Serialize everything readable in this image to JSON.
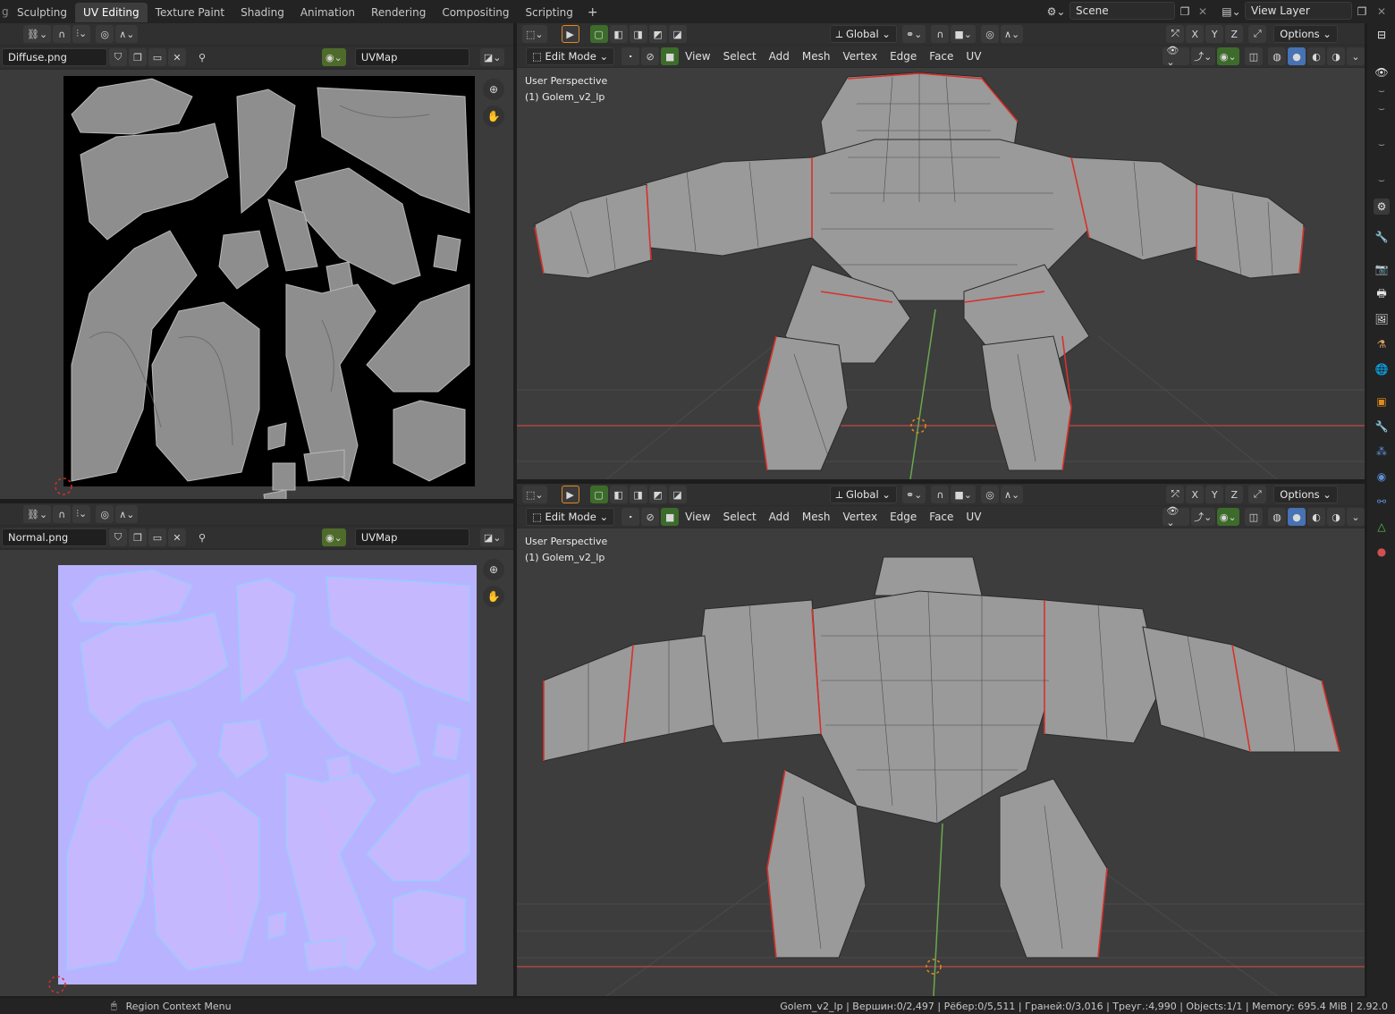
{
  "workspace_tabs": [
    "Sculpting",
    "UV Editing",
    "Texture Paint",
    "Shading",
    "Animation",
    "Rendering",
    "Compositing",
    "Scripting"
  ],
  "active_tab": "UV Editing",
  "add_tab_symbol": "+",
  "scene": {
    "label": "Scene"
  },
  "view_layer": {
    "label": "View Layer"
  },
  "uv_editor_top": {
    "image_name": "Diffuse.png",
    "uvmap": "UVMap"
  },
  "uv_editor_bottom": {
    "image_name": "Normal.png",
    "uvmap": "UVMap"
  },
  "viewport_top": {
    "mode": "Edit Mode",
    "menus": [
      "View",
      "Select",
      "Add",
      "Mesh",
      "Vertex",
      "Edge",
      "Face",
      "UV"
    ],
    "orientation": "Global",
    "axes": [
      "X",
      "Y",
      "Z"
    ],
    "options": "Options",
    "perspective": "User Perspective",
    "object": "(1) Golem_v2_lp"
  },
  "viewport_bottom": {
    "mode": "Edit Mode",
    "menus": [
      "View",
      "Select",
      "Add",
      "Mesh",
      "Vertex",
      "Edge",
      "Face",
      "UV"
    ],
    "orientation": "Global",
    "axes": [
      "X",
      "Y",
      "Z"
    ],
    "options": "Options",
    "perspective": "User Perspective",
    "object": "(1) Golem_v2_lp"
  },
  "status": {
    "context": "Region Context Menu",
    "stats": "Golem_v2_lp | Вершин:0/2,497 | Рёбер:0/5,511 | Граней:0/3,016 | Треуг.:4,990 | Objects:1/1 | Memory: 695.4 MiB | 2.92.0"
  },
  "colors": {
    "accent": "#4772b3",
    "edge_seam": "#d7312b",
    "uv_bg": "#000000",
    "normal_bg": "#b9b3ff"
  }
}
